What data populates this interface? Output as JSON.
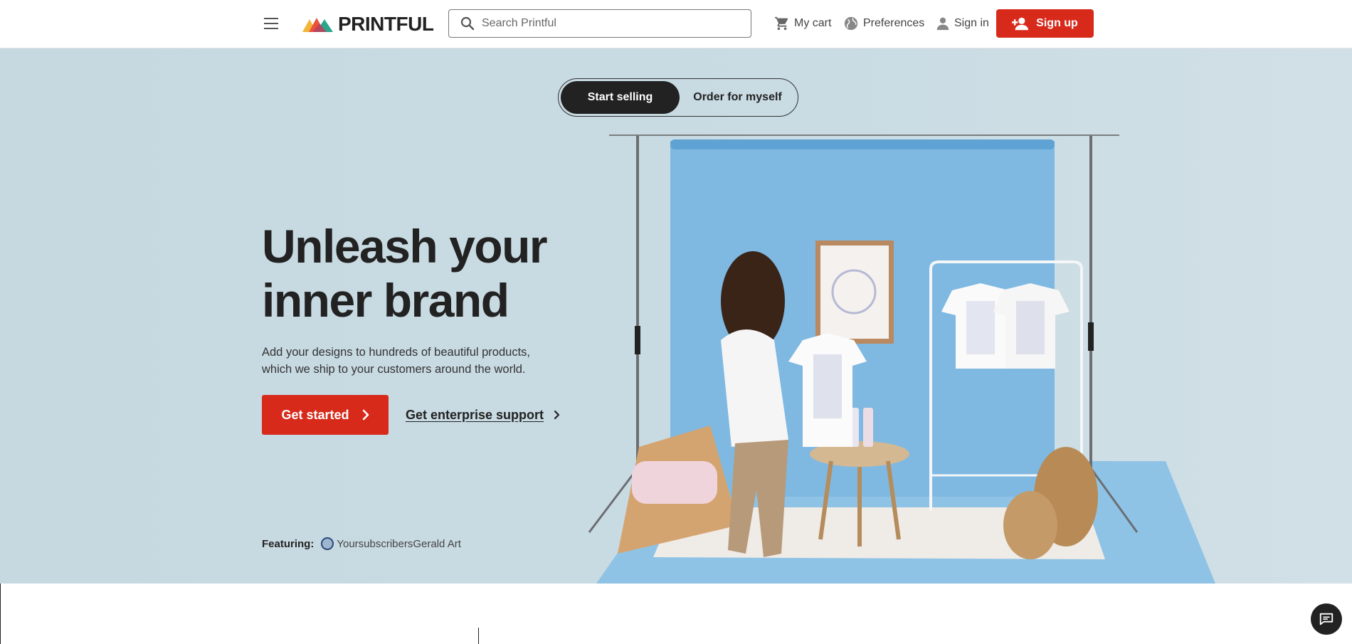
{
  "header": {
    "logo_text": "PRINTFUL",
    "search_placeholder": "Search Printful",
    "cart_label": "My cart",
    "preferences_label": "Preferences",
    "signin_label": "Sign in",
    "signup_label": "Sign up"
  },
  "hero": {
    "toggle": {
      "active": "Start selling",
      "inactive": "Order for myself"
    },
    "headline_line1": "Unleash your",
    "headline_line2": "inner brand",
    "subtext": "Add your designs to hundreds of beautiful products, which we ship to your customers around the world.",
    "cta_label": "Get started",
    "enterprise_label": "Get enterprise support",
    "featuring_label": "Featuring:",
    "featuring_name": "YoursubscribersGerald Art"
  },
  "colors": {
    "brand_red": "#d72a1b",
    "hero_bg": "#c9dbe3",
    "backdrop_blue": "#7fb9e2",
    "dark": "#222222"
  },
  "icons": [
    "menu-icon",
    "search-icon",
    "cart-icon",
    "globe-icon",
    "person-icon",
    "add-person-icon",
    "chevron-right-icon",
    "chat-icon"
  ]
}
